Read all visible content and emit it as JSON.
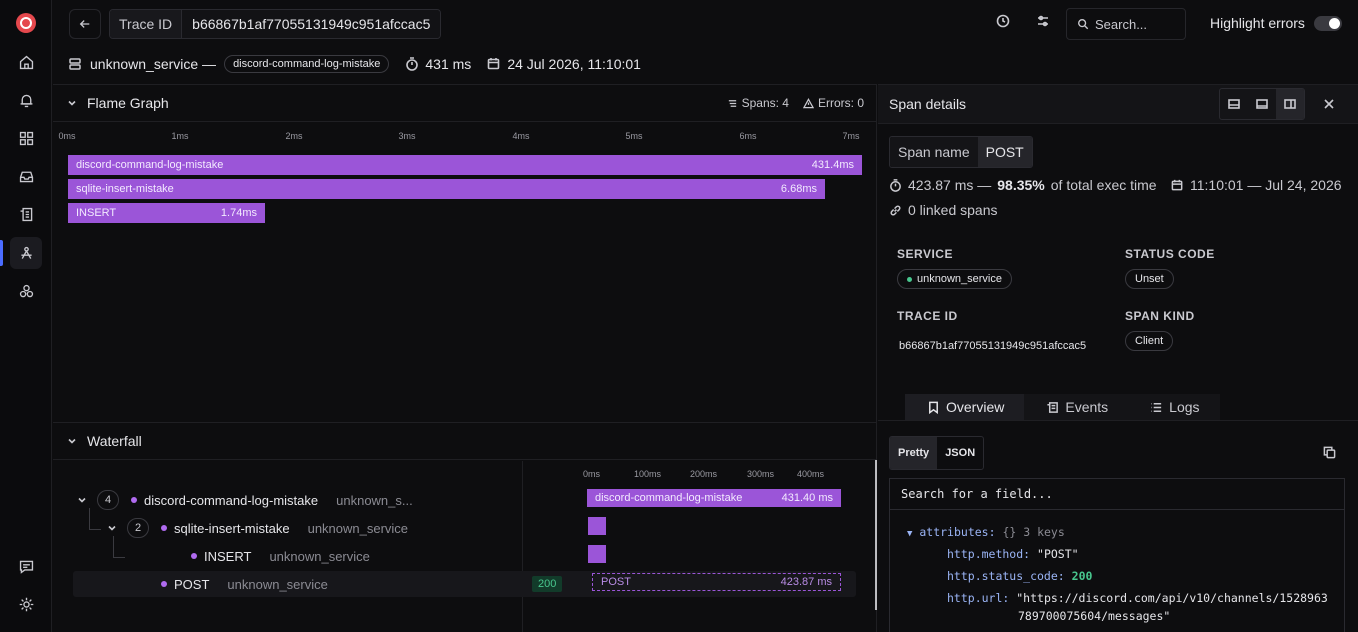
{
  "topbar": {
    "trace_id_label": "Trace ID",
    "trace_id_value": "b66867b1af77055131949c951afccac5",
    "search_placeholder": "Search...",
    "highlight_errors_label": "Highlight errors",
    "highlight_errors_on": false
  },
  "meta": {
    "service": "unknown_service —",
    "root_span_chip": "discord-command-log-mistake",
    "duration": "431 ms",
    "timestamp": "24 Jul 2026, 11:10:01"
  },
  "flame": {
    "title": "Flame Graph",
    "spans_label": "Spans: 4",
    "errors_label": "Errors: 0",
    "axis_ticks": [
      "0ms",
      "1ms",
      "2ms",
      "3ms",
      "4ms",
      "5ms",
      "6ms",
      "7ms"
    ],
    "bars": [
      {
        "name": "discord-command-log-mistake",
        "duration": "431.4ms"
      },
      {
        "name": "sqlite-insert-mistake",
        "duration": "6.68ms"
      },
      {
        "name": "INSERT",
        "duration": "1.74ms"
      }
    ]
  },
  "waterfall": {
    "title": "Waterfall",
    "axis_ticks": [
      "0ms",
      "100ms",
      "200ms",
      "300ms",
      "400ms"
    ],
    "rows": [
      {
        "count": "4",
        "name": "discord-command-log-mistake",
        "service": "unknown_s...",
        "bar_label": "discord-command-log-mistake",
        "bar_duration": "431.40 ms"
      },
      {
        "count": "2",
        "name": "sqlite-insert-mistake",
        "service": "unknown_service"
      },
      {
        "name": "INSERT",
        "service": "unknown_service"
      },
      {
        "name": "POST",
        "service": "unknown_service",
        "status": "200",
        "bar_label": "POST",
        "bar_duration": "423.87 ms"
      }
    ]
  },
  "details": {
    "title": "Span details",
    "span_name_label": "Span name",
    "span_name_value": "POST",
    "duration_text": "423.87 ms —",
    "percent_text": "98.35%",
    "percent_suffix": "of total exec time",
    "time_text": "11:10:01 — Jul 24, 2026",
    "linked_spans": "0 linked spans",
    "service_label": "SERVICE",
    "service_value": "unknown_service",
    "status_code_label": "STATUS CODE",
    "status_code_value": "Unset",
    "trace_id_label": "TRACE ID",
    "trace_id_value": "b66867b1af77055131949c951afccac5",
    "span_kind_label": "SPAN KIND",
    "span_kind_value": "Client",
    "tabs": [
      "Overview",
      "Events",
      "Logs"
    ],
    "format_pretty": "Pretty",
    "format_json": "JSON",
    "field_search_placeholder": "Search for a field...",
    "json": {
      "attributes_key": "attributes:",
      "attributes_meta": "{} 3 keys",
      "method_key": "http.method:",
      "method_value": "\"POST\"",
      "status_key": "http.status_code:",
      "status_value": "200",
      "url_key": "http.url:",
      "url_value_1": "\"https://discord.com/api/v10/channels/1528963",
      "url_value_2": "789700075604/messages\""
    }
  },
  "colors": {
    "span_purple": "#9b55d8",
    "accent_blue": "#4b6cff",
    "success_green": "#48c78e"
  }
}
